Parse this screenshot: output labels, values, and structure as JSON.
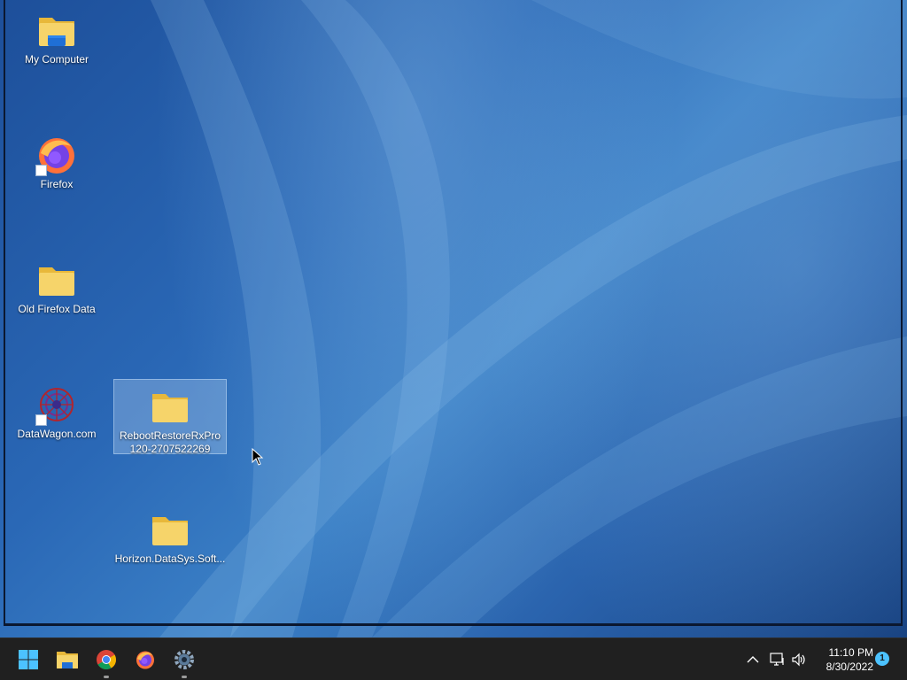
{
  "desktop": {
    "icons": [
      {
        "label": "My Computer"
      },
      {
        "label": "Firefox"
      },
      {
        "label": "Old Firefox Data"
      },
      {
        "label": "DataWagon.com"
      },
      {
        "label": "RebootRestoreRxPro120-2707522269"
      },
      {
        "label": "Horizon.DataSys.Soft..."
      }
    ]
  },
  "taskbar": {
    "pinned": [
      "windows-start-icon",
      "file-explorer-icon",
      "chrome-icon",
      "firefox-icon",
      "settings-icon"
    ],
    "clock": {
      "time": "11:10 PM",
      "date": "8/30/2022"
    },
    "notification_count": "1"
  },
  "colors": {
    "taskbar": "#202020",
    "folder": "#f6d46a",
    "accent": "#4cc2ff"
  }
}
